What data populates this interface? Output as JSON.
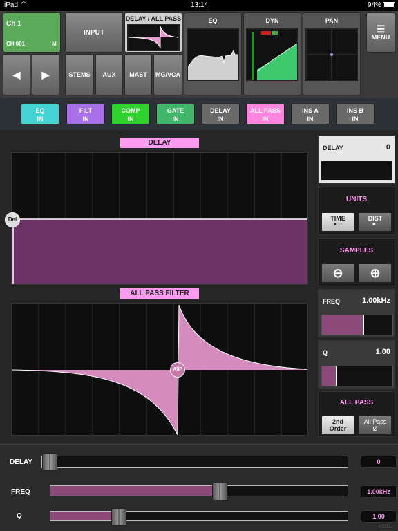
{
  "status": {
    "device": "iPad",
    "time": "13:14",
    "battery": "94%"
  },
  "header": {
    "channel": {
      "name": "Ch 1",
      "id": "CH 001",
      "mode": "M"
    },
    "input_label": "INPUT",
    "stems_label": "STEMS",
    "aux_label": "AUX",
    "mast_label": "MAST",
    "mgvca_label": "MG/VCA",
    "delay_allpass_title": "DELAY / ALL PASS",
    "eq_title": "EQ",
    "dyn_title": "DYN",
    "pan_title": "PAN",
    "menu_label": "MENU"
  },
  "chips": [
    {
      "top": "EQ",
      "bottom": "IN",
      "color": "#45d2d2"
    },
    {
      "top": "FILT",
      "bottom": "IN",
      "color": "#a870e6"
    },
    {
      "top": "COMP",
      "bottom": "IN",
      "color": "#2ed12e"
    },
    {
      "top": "GATE",
      "bottom": "IN",
      "color": "#41b56a"
    },
    {
      "top": "DELAY",
      "bottom": "IN",
      "color": "#6a6a6a"
    },
    {
      "top": "ALL PASS",
      "bottom": "IN",
      "color": "#ff85e0"
    },
    {
      "top": "INS A",
      "bottom": "IN",
      "color": "#6a6a6a"
    },
    {
      "top": "INS B",
      "bottom": "IN",
      "color": "#6a6a6a"
    }
  ],
  "graphs": {
    "delay_title": "DELAY",
    "delay_handle": "Del",
    "allpass_title": "ALL PASS FILTER",
    "allpass_handle": "AllP"
  },
  "side": {
    "delay_label": "DELAY",
    "delay_value": "0",
    "units_title": "UNITS",
    "time_label": "TIME",
    "time_dots": "●○○",
    "dist_label": "DIST",
    "dist_dots": "●○",
    "samples_title": "SAMPLES",
    "freq_label": "FREQ",
    "freq_value": "1.00kHz",
    "freq_level": 0.6,
    "q_label": "Q",
    "q_value": "1.00",
    "q_level": 0.22,
    "allpass_title": "ALL PASS",
    "order_label_1": "2nd",
    "order_label_2": "Order",
    "phase_label_1": "All Pass",
    "phase_label_2": "Ø"
  },
  "faders": [
    {
      "label": "DELAY",
      "value": "0",
      "level": 0.0
    },
    {
      "label": "FREQ",
      "value": "1.00kHz",
      "level": 0.57
    },
    {
      "label": "Q",
      "value": "1.00",
      "level": 0.23
    }
  ],
  "version": "v 3.0.11",
  "colors": {
    "accent": "#ff9af0",
    "fill": "#8c4a7a"
  }
}
